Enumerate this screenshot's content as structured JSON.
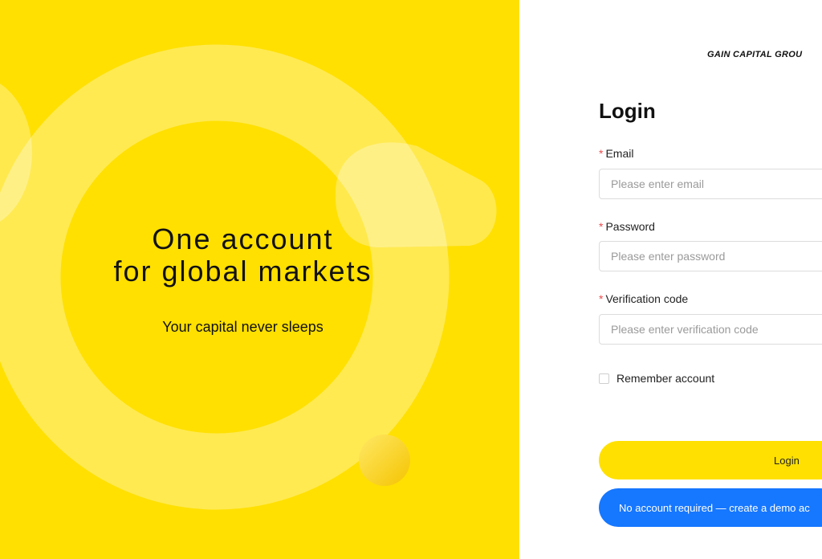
{
  "hero": {
    "title_line1": "One account",
    "title_line2": "for global markets",
    "subtitle": "Your capital never sleeps",
    "background_color": "#FFE000"
  },
  "panel": {
    "brand": "GAIN CAPITAL GROU",
    "title": "Login",
    "email": {
      "label": "Email",
      "required_mark": "*",
      "placeholder": "Please enter email",
      "value": ""
    },
    "password": {
      "label": "Password",
      "required_mark": "*",
      "placeholder": "Please enter password",
      "value": ""
    },
    "verification": {
      "label": "Verification code",
      "required_mark": "*",
      "placeholder": "Please enter verification code",
      "value": ""
    },
    "remember": {
      "label": "Remember account",
      "checked": false
    },
    "login_button": "Login",
    "demo_button": "No account required — create a demo ac",
    "accent_color": "#FFE000",
    "demo_color": "#1677FF",
    "required_color": "#E84D4D"
  }
}
